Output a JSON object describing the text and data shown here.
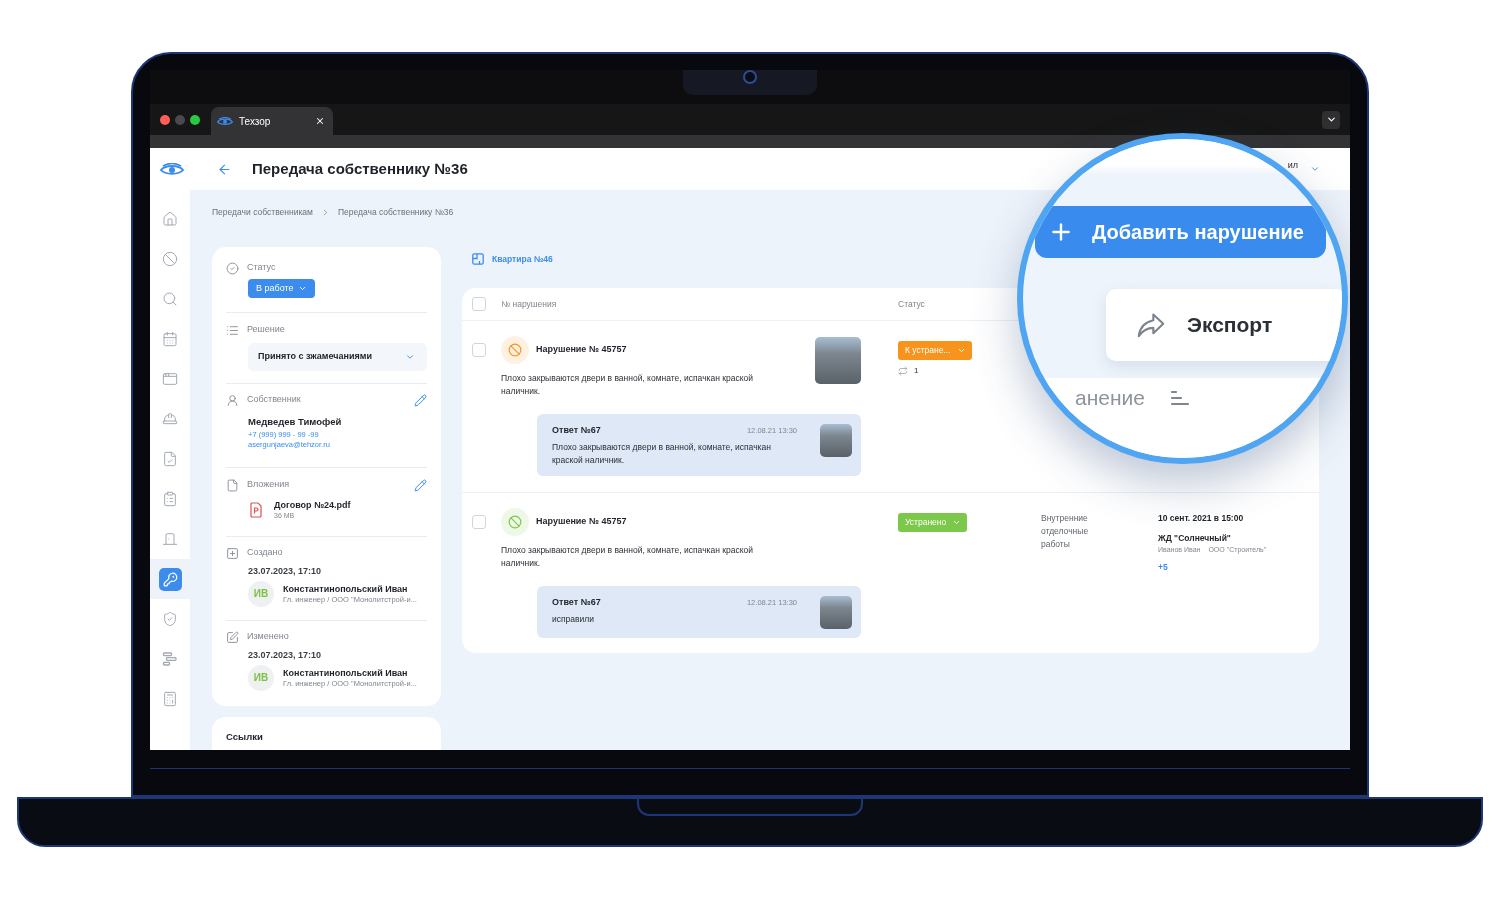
{
  "browser": {
    "tabs": [
      {
        "title": "Техзор",
        "selected": true
      }
    ]
  },
  "header": {
    "title": "Передача собственнику №36",
    "user": "ил"
  },
  "sidebar": {
    "items": [
      {
        "selected": false
      },
      {
        "selected": false
      },
      {
        "selected": false
      },
      {
        "selected": false
      },
      {
        "selected": false
      },
      {
        "selected": false
      },
      {
        "selected": false
      },
      {
        "selected": false
      },
      {
        "selected": false
      },
      {
        "selected": true
      },
      {
        "selected": false
      },
      {
        "selected": false
      },
      {
        "selected": false
      }
    ]
  },
  "breadcrumbs": [
    "Передачи собственникам",
    "Передача собственнику №36"
  ],
  "details": {
    "status": {
      "label": "Статус",
      "value": "В работе"
    },
    "decision": {
      "label": "Решение",
      "value": "Принято с зжамечаниями"
    },
    "owner": {
      "label": "Собственник",
      "editable": true,
      "name": "Медведев Тимофей",
      "phone": "+7 (999) 999 - 99 -99",
      "email": "asergunjaeva@tehzor.ru"
    },
    "attachments": {
      "label": "Вложения",
      "editable": true,
      "files": [
        {
          "name": "Договор №24.pdf",
          "size": "36 MB"
        }
      ]
    },
    "created": {
      "label": "Создано",
      "date": "23.07.2023, 17:10",
      "user": {
        "initials": "ИВ",
        "name": "Константинопольский Иван",
        "role": "Гл. инженер / ООО \"Монолитстрой-и..."
      }
    },
    "modified": {
      "label": "Изменено",
      "date": "23.07.2023, 17:10",
      "user": {
        "initials": "ИВ",
        "name": "Константинопольский Иван",
        "role": "Гл. инженер / ООО \"Монолитстрой-и..."
      }
    }
  },
  "links": {
    "title": "Ссылки"
  },
  "apartment": "Квартира №46",
  "table": {
    "header_checkbox": {
      "checked": false
    },
    "columns": [
      "№ нарушения",
      "Статус"
    ],
    "rows": [
      {
        "checked": false,
        "title": "Нарушение № 45757",
        "description": "Плохо закрываются двери в ванной, комнате, испачкан краской наличник.",
        "photo": true,
        "status": {
          "label": "К устране...",
          "color": "#f7941d"
        },
        "repeats": "1",
        "reply": {
          "title": "Ответ №67",
          "date": "12.08.21 13:30",
          "text": "Плохо закрываются двери в ванной, комнате, испачкан краской наличник.",
          "photo": true
        }
      },
      {
        "checked": false,
        "title": "Нарушение № 45757",
        "description": "Плохо закрываются двери в ванной, комнате, испачкан краской наличник.",
        "photo": false,
        "status": {
          "label": "Устранено",
          "color": "#7cc84a"
        },
        "category": "Внутренние отделочные работы",
        "details": {
          "date": "10 сент. 2021 в 15:00",
          "object": "ЖД \"Солнечный\"",
          "person": "Иванов Иван",
          "company": "ООО \"Строитель\"",
          "more": "+5"
        },
        "reply": {
          "title": "Ответ №67",
          "date": "12.08.21 13:30",
          "text": "исправили",
          "photo": true
        }
      }
    ]
  },
  "magnifier": {
    "add_button": "Добавить нарушение",
    "export_button": "Экспорт",
    "column_header": "анение"
  }
}
